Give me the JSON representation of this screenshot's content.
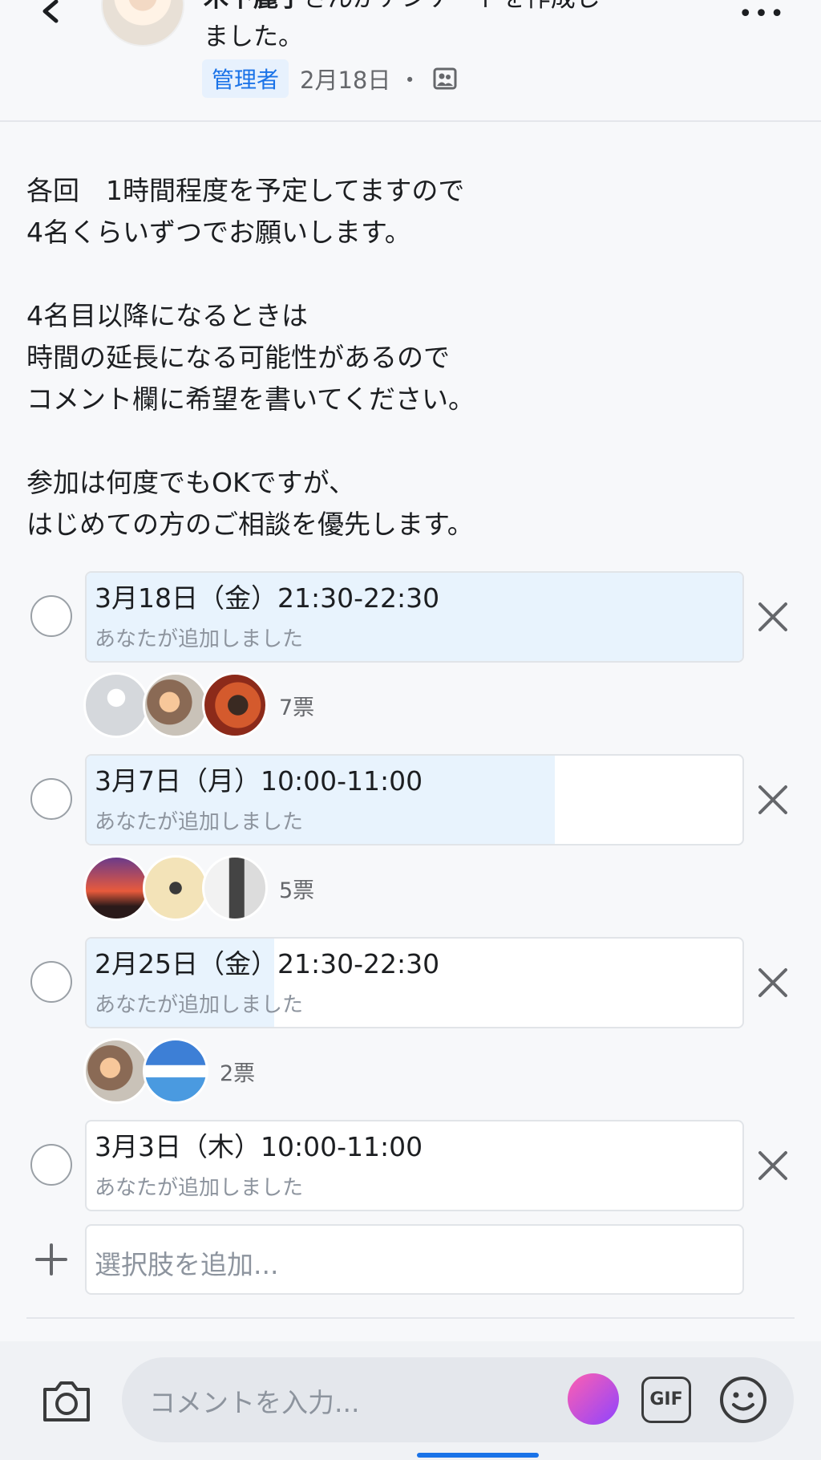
{
  "header": {
    "author_name": "木下麗子",
    "action_text": "さんがアンケートを作成し",
    "action_text_2": "ました。",
    "role_badge": "管理者",
    "date": "2月18日 ・",
    "more_label": "•••"
  },
  "post": {
    "body": "各回　1時間程度を予定してますので\n4名くらいずつでお願いします。\n\n4名目以降になるときは\n時間の延長になる可能性があるので\nコメント欄に希望を書いてください。\n\n参加は何度でもOKですが、\nはじめての方のご相談を優先します。"
  },
  "poll": {
    "options": [
      {
        "label": "3月18日（金）21:30-22:30",
        "added_by": "あなたが追加しました",
        "votes_text": "7票",
        "votes": 7,
        "voters": 3
      },
      {
        "label": "3月7日（月）10:00-11:00",
        "added_by": "あなたが追加しました",
        "votes_text": "5票",
        "votes": 5,
        "voters": 3
      },
      {
        "label": "2月25日（金）21:30-22:30",
        "added_by": "あなたが追加しました",
        "votes_text": "2票",
        "votes": 2,
        "voters": 2
      },
      {
        "label": "3月3日（木）10:00-11:00",
        "added_by": "あなたが追加しました",
        "votes_text": "",
        "votes": 0,
        "voters": 0
      }
    ],
    "add_placeholder": "選択肢を追加..."
  },
  "composer": {
    "placeholder": "コメントを入力...",
    "gif_label": "GIF"
  },
  "colors": {
    "accent": "#1a73e8",
    "vote_fill": "#e8f3fd",
    "badge_bg": "#e7f1fd"
  }
}
